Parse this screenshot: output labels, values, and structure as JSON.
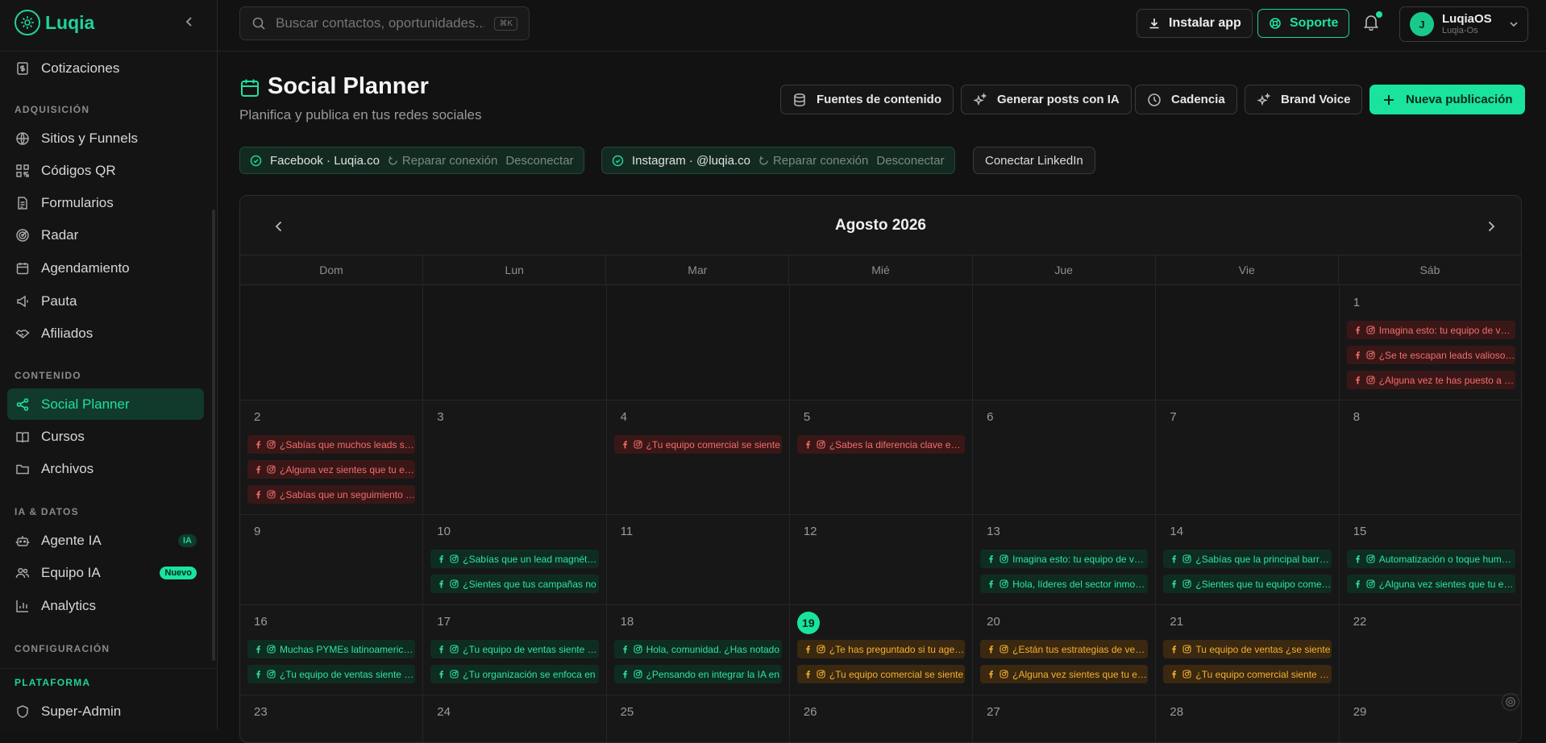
{
  "brand": {
    "name": "Luqia"
  },
  "sidebar": {
    "top_items": [
      {
        "label": "Cotizaciones",
        "icon": "quote-doc-icon"
      }
    ],
    "sections": [
      {
        "title": "ADQUISICIÓN",
        "items": [
          {
            "label": "Sitios y Funnels",
            "icon": "globe-icon"
          },
          {
            "label": "Códigos QR",
            "icon": "qr-code-icon"
          },
          {
            "label": "Formularios",
            "icon": "form-icon"
          },
          {
            "label": "Radar",
            "icon": "radar-icon"
          },
          {
            "label": "Agendamiento",
            "icon": "calendar-icon"
          },
          {
            "label": "Pauta",
            "icon": "megaphone-icon"
          },
          {
            "label": "Afiliados",
            "icon": "handshake-icon"
          }
        ]
      },
      {
        "title": "CONTENIDO",
        "items": [
          {
            "label": "Social Planner",
            "icon": "share-icon",
            "active": true
          },
          {
            "label": "Cursos",
            "icon": "book-icon"
          },
          {
            "label": "Archivos",
            "icon": "folder-icon"
          }
        ]
      },
      {
        "title": "IA & DATOS",
        "items": [
          {
            "label": "Agente IA",
            "icon": "bot-icon",
            "badge": "IA"
          },
          {
            "label": "Equipo IA",
            "icon": "users-icon",
            "badge": "Nuevo"
          },
          {
            "label": "Analytics",
            "icon": "bar-chart-icon"
          }
        ]
      },
      {
        "title": "CONFIGURACIÓN",
        "items": []
      }
    ],
    "platform": {
      "title": "PLATAFORMA",
      "items": [
        {
          "label": "Super-Admin",
          "icon": "shield-icon"
        }
      ]
    }
  },
  "topbar": {
    "search_placeholder": "Buscar contactos, oportunidades...",
    "search_kbd": "⌘K",
    "install_label": "Instalar app",
    "support_label": "Soporte",
    "user": {
      "initial": "J",
      "name": "LuqiaOS",
      "sub": "Luqia-Os"
    }
  },
  "page": {
    "title": "Social Planner",
    "subtitle": "Planifica y publica en tus redes sociales",
    "actions": [
      {
        "label": "Fuentes de contenido",
        "icon": "database-icon"
      },
      {
        "label": "Generar posts con IA",
        "icon": "sparkles-icon"
      },
      {
        "label": "Cadencia",
        "icon": "clock-icon"
      },
      {
        "label": "Brand Voice",
        "icon": "sparkles-icon"
      },
      {
        "label": "Nueva publicación",
        "icon": "plus-icon",
        "primary": true
      }
    ],
    "connections": [
      {
        "label": "Facebook · Luqia.co",
        "repair": "Reparar conexión",
        "disconnect": "Desconectar"
      },
      {
        "label": "Instagram · @luqia.co",
        "repair": "Reparar conexión",
        "disconnect": "Desconectar"
      }
    ],
    "connect_linkedin": "Conectar LinkedIn"
  },
  "calendar": {
    "month": "Agosto 2026",
    "weekdays": [
      "Dom",
      "Lun",
      "Mar",
      "Mié",
      "Jue",
      "Vie",
      "Sáb"
    ],
    "first_weekday": 6,
    "days_shown": 29,
    "today": 19,
    "colors": {
      "red": "#f26d6d",
      "green": "#2fe3a6",
      "orange": "#f5b030",
      "accent": "#19e39d"
    },
    "events": {
      "1": [
        {
          "text": "Imagina esto: tu equipo de ventas",
          "status": "red"
        },
        {
          "text": "¿Se te escapan leads valiosos por",
          "status": "red"
        },
        {
          "text": "¿Alguna vez te has puesto a pensar",
          "status": "red"
        }
      ],
      "2": [
        {
          "text": "¿Sabías que muchos leads se pierden",
          "status": "red"
        },
        {
          "text": "¿Alguna vez sientes que tu equipo",
          "status": "red"
        },
        {
          "text": "¿Sabías que un seguimiento a tiempo",
          "status": "red"
        }
      ],
      "4": [
        {
          "text": "¿Tu equipo comercial se siente",
          "status": "red"
        }
      ],
      "5": [
        {
          "text": "¿Sabes la diferencia clave entre",
          "status": "red"
        }
      ],
      "10": [
        {
          "text": "¿Sabías que un lead magnético",
          "status": "green"
        },
        {
          "text": "¿Sientes que tus campañas no",
          "status": "green"
        }
      ],
      "13": [
        {
          "text": "Imagina esto: tu equipo de ventas",
          "status": "green"
        },
        {
          "text": "Hola, líderes del sector inmobiliario",
          "status": "green"
        }
      ],
      "14": [
        {
          "text": "¿Sabías que la principal barrera",
          "status": "green"
        },
        {
          "text": "¿Sientes que tu equipo comercial",
          "status": "green"
        }
      ],
      "15": [
        {
          "text": "Automatización o toque humano",
          "status": "green"
        },
        {
          "text": "¿Alguna vez sientes que tu equipo",
          "status": "green"
        }
      ],
      "16": [
        {
          "text": "Muchas PYMEs latinoamericanas",
          "status": "green"
        },
        {
          "text": "¿Tu equipo de ventas siente que",
          "status": "green"
        }
      ],
      "17": [
        {
          "text": "¿Tu equipo de ventas siente que",
          "status": "green"
        },
        {
          "text": "¿Tu organización se enfoca en",
          "status": "green"
        }
      ],
      "18": [
        {
          "text": "Hola, comunidad. ¿Has notado",
          "status": "green"
        },
        {
          "text": "¿Pensando en integrar la IA en",
          "status": "green"
        }
      ],
      "19": [
        {
          "text": "¿Te has preguntado si tu agencia",
          "status": "orange"
        },
        {
          "text": "¿Tu equipo comercial se siente",
          "status": "orange"
        }
      ],
      "20": [
        {
          "text": "¿Están tus estrategias de venta",
          "status": "orange"
        },
        {
          "text": "¿Alguna vez sientes que tu equipo",
          "status": "orange"
        }
      ],
      "21": [
        {
          "text": "Tu equipo de ventas ¿se siente",
          "status": "orange"
        },
        {
          "text": "¿Tu equipo comercial siente que",
          "status": "orange"
        }
      ]
    }
  }
}
